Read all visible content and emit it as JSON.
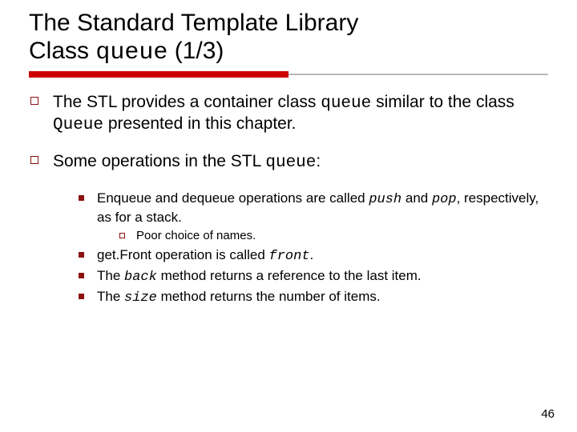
{
  "title": {
    "line1_pre": "The Standard Template Library",
    "line2_pre": "Class ",
    "line2_mono": "queue",
    "line2_post": " (1/3)"
  },
  "bullets": {
    "b1": {
      "pre": "The STL provides a container class ",
      "code1": "queue",
      "mid": " similar to the class ",
      "code2": "Queue",
      "post": " presented in this chapter."
    },
    "b2": {
      "pre": "Some operations in the STL ",
      "code": "queue",
      "post": ":"
    }
  },
  "sub": {
    "s1": {
      "pre": "Enqueue and dequeue operations are called ",
      "code1": "push",
      "mid": " and ",
      "code2": "pop",
      "post": ", respectively, as for a stack."
    },
    "s1a": "Poor choice of names.",
    "s2": {
      "pre": "get.Front operation is called ",
      "code": "front",
      "post": "."
    },
    "s3": {
      "pre": "The ",
      "code": "back",
      "post": " method returns a reference to the last item."
    },
    "s4": {
      "pre": "The ",
      "code": "size",
      "post": " method returns the number of items."
    }
  },
  "page_number": "46"
}
